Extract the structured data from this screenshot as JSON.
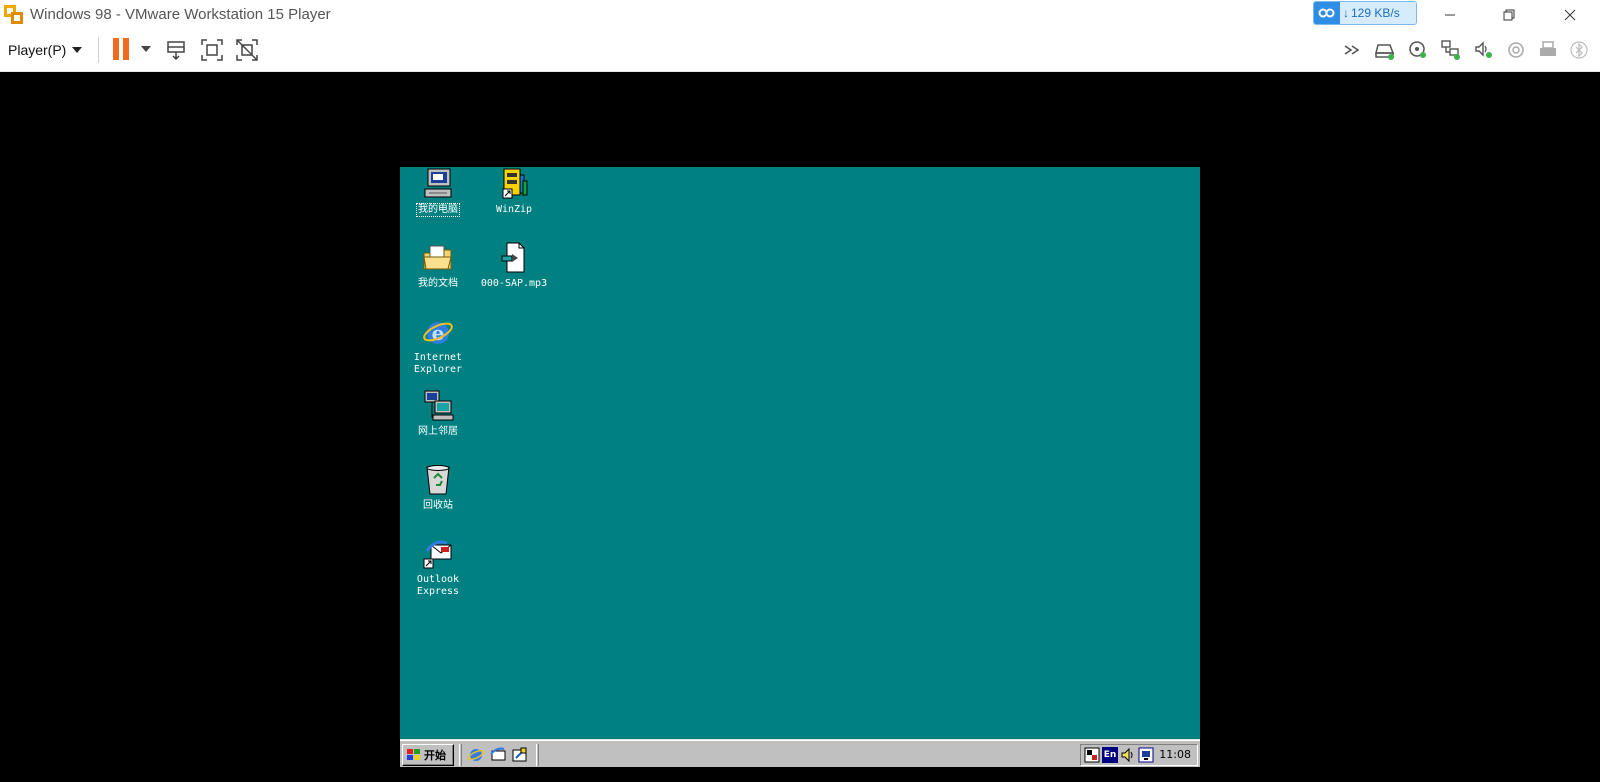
{
  "window": {
    "title": "Windows 98 - VMware Workstation 15 Player",
    "netspeed": "129 KB/s"
  },
  "toolbar": {
    "player_menu_label": "Player(P)"
  },
  "desktop": {
    "icons": [
      {
        "label": "我的电脑",
        "icon": "my-computer-icon"
      },
      {
        "label": "WinZip",
        "icon": "winzip-icon"
      },
      {
        "label": "我的文档",
        "icon": "my-documents-icon"
      },
      {
        "label": "000-SAP.mp3",
        "icon": "mp3-file-icon"
      },
      {
        "label": "Internet\nExplorer",
        "icon": "internet-explorer-icon"
      },
      {
        "label": "网上邻居",
        "icon": "network-neighborhood-icon"
      },
      {
        "label": "回收站",
        "icon": "recycle-bin-icon"
      },
      {
        "label": "Outlook\nExpress",
        "icon": "outlook-express-icon"
      }
    ]
  },
  "taskbar": {
    "start_label": "开始",
    "tray_language": "En",
    "clock": "11:08"
  },
  "colors": {
    "desktop_bg": "#008080",
    "taskbar_bg": "#c0c0c0",
    "pause_accent": "#f26a1b"
  }
}
